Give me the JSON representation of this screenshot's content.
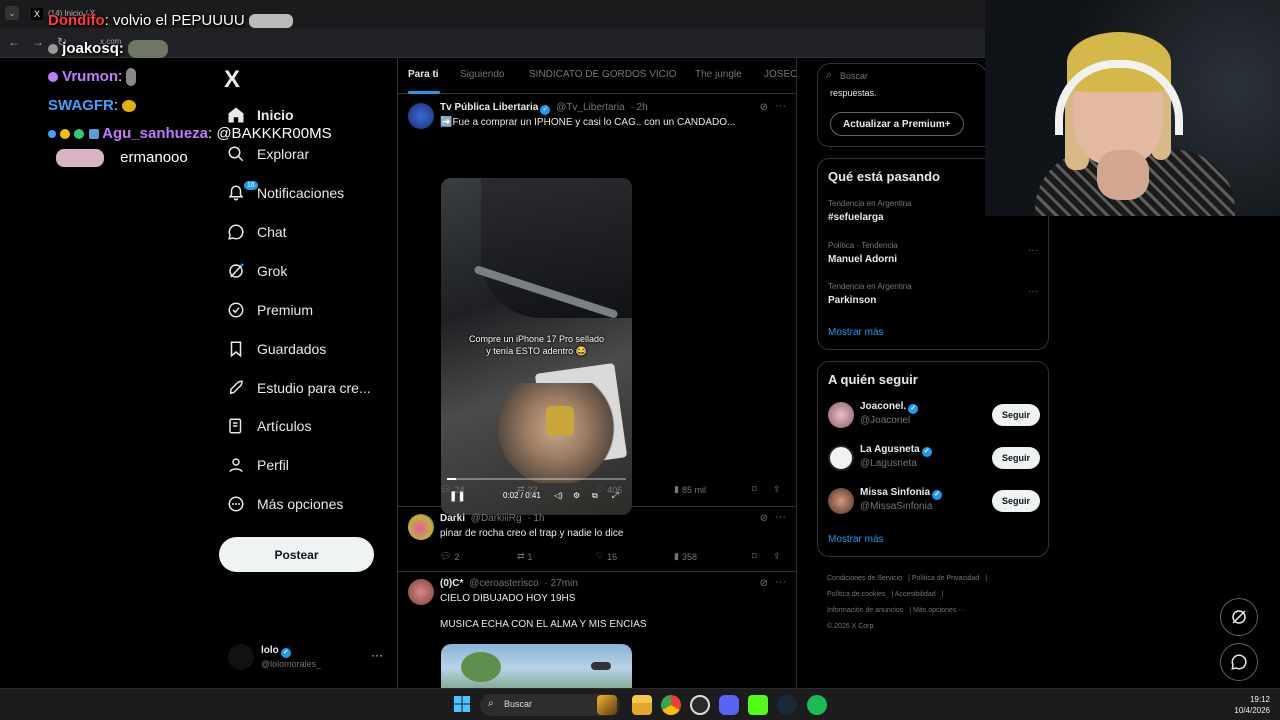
{
  "browser": {
    "tab_title": "(14) Inicio / X",
    "url": "x.com"
  },
  "stream_chat": [
    {
      "user": "Dondifo",
      "user_color": "#ff3b3b",
      "message": ": volvio el PEPUUUU"
    },
    {
      "user": "joakosq:",
      "user_color": "#ffffff",
      "message": ""
    },
    {
      "user": "Vrumon",
      "user_color": "#c07cff",
      "message": ":"
    },
    {
      "user": "SWAGFR",
      "user_color": "#3fa0ff",
      "message": ":"
    },
    {
      "user": "Agu_sanhueza",
      "user_color": "#c07cff",
      "message": ": @BAKKKR00MS"
    },
    {
      "user": "",
      "user_color": "#ffffff",
      "message": "ermanooo"
    }
  ],
  "nav": {
    "logo": "X",
    "notif_badge": "16",
    "items": [
      {
        "label": "Inicio"
      },
      {
        "label": "Explorar"
      },
      {
        "label": "Notificaciones"
      },
      {
        "label": "Chat"
      },
      {
        "label": "Grok"
      },
      {
        "label": "Premium"
      },
      {
        "label": "Guardados"
      },
      {
        "label": "Estudio para cre..."
      },
      {
        "label": "Artículos"
      },
      {
        "label": "Perfil"
      },
      {
        "label": "Más opciones"
      }
    ],
    "post_button": "Postear",
    "profile": {
      "name": "lolo",
      "handle": "@lolomorales_",
      "more": "···"
    }
  },
  "feed": {
    "tabs": [
      "Para ti",
      "Siguiendo",
      "SINDICATO DE GORDOS VICIO",
      "The jungle",
      "JOSEO"
    ],
    "posts": [
      {
        "name": "Tv Pública Libertaria",
        "handle": "@Tv_Libertaria",
        "time": "· 2h",
        "text": "➡️Fue a comprar un IPHONE y casi lo CAG.. con un CANDADO...",
        "video_caption_1": "Compre un iPhone 17 Pro sellado",
        "video_caption_2": "y tenía ESTO adentro 😂",
        "video_time": "0:02 / 0:41",
        "video_progress": 0.05,
        "replies": "24",
        "reposts": "22",
        "likes": "406",
        "views": "85 mil"
      },
      {
        "name": "Darki",
        "handle": "@DarkiiiRg",
        "time": "· 1h",
        "text": "pinar de rocha creo el trap y nadie lo dice",
        "replies": "2",
        "reposts": "1",
        "likes": "16",
        "views": "358"
      },
      {
        "name": "(0)C*",
        "handle": "@ceroasterisco",
        "time": "· 27min",
        "text_1": "CIELO DIBUJADO HOY 19HS",
        "text_2": "MUSICA ECHA CON EL ALMA Y MIS ENCIAS"
      }
    ]
  },
  "sidebar": {
    "search_placeholder": "Buscar",
    "premium_text": "respuestas.",
    "premium_button": "Actualizar a Premium+",
    "trends_title": "Qué está pasando",
    "trends": [
      {
        "meta": "Tendencia en Argentina",
        "name": "#sefuelarga"
      },
      {
        "meta": "Política · Tendencia",
        "name": "Manuel Adorni"
      },
      {
        "meta": "Tendencia en Argentina",
        "name": "Parkinson"
      }
    ],
    "trends_more": "Mostrar más",
    "follow_title": "A quién seguir",
    "follow": [
      {
        "name": "Joaconel.",
        "handle": "@Joaconel",
        "button": "Seguir"
      },
      {
        "name": "La Agusneta",
        "handle": "@Lagusneta",
        "button": "Seguir"
      },
      {
        "name": "Missa Sinfonia",
        "handle": "@MissaSinfonia",
        "button": "Seguir"
      }
    ],
    "follow_more": "Mostrar más",
    "footer": [
      "Condiciones de Servicio",
      "Política de Privacidad",
      "Política de cookies",
      "Accesibilidad",
      "Información de anuncios",
      "Más opciones ···",
      "© 2026 X Corp."
    ]
  },
  "taskbar": {
    "search": "Buscar",
    "time": "19:12",
    "date": "10/4/2026"
  }
}
